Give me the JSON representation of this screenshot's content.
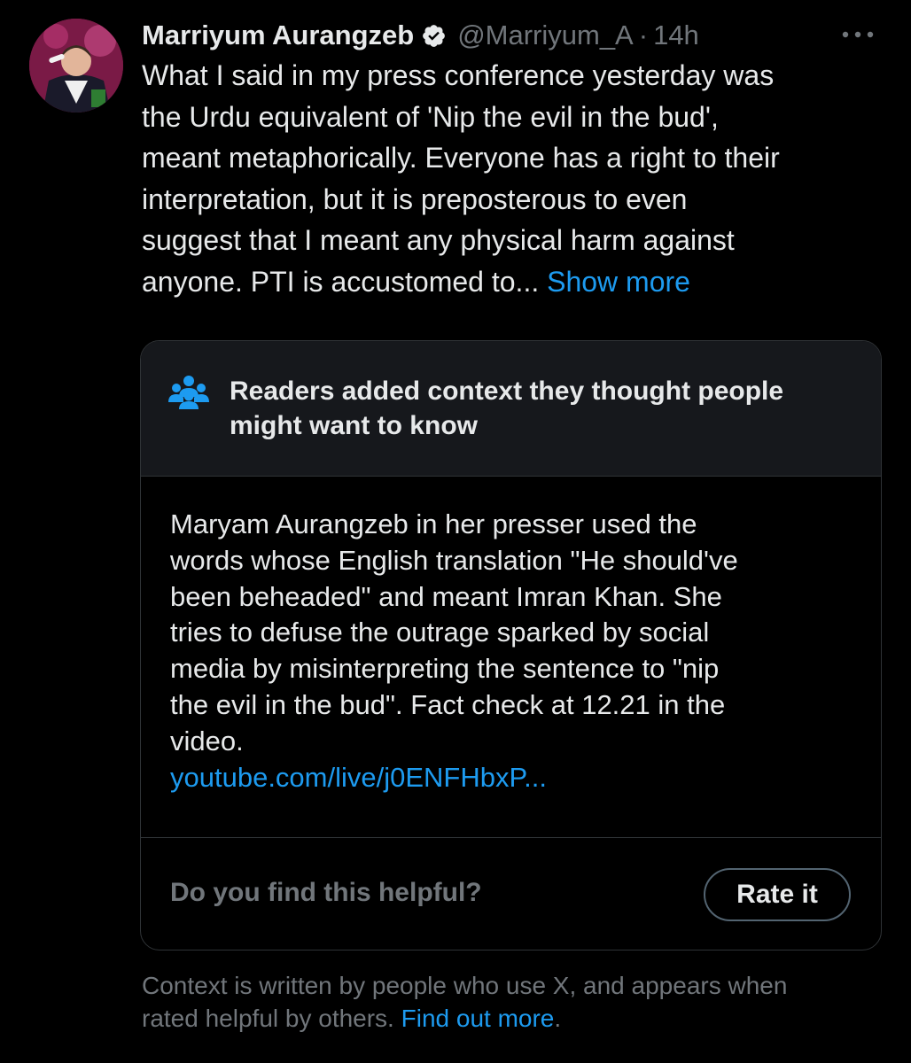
{
  "tweet": {
    "display_name": "Marriyum Aurangzeb",
    "handle": "@Marriyum_A",
    "separator": "·",
    "time": "14h",
    "verified_icon": "verified-badge-icon",
    "more_icon": "more-horizontal-icon",
    "text_lines": [
      "What I said in my press conference yesterday was",
      "the Urdu equivalent of 'Nip the evil in the bud',",
      "meant metaphorically. Everyone has a right to their",
      "interpretation, but it is preposterous to even",
      "suggest that I meant any physical harm against",
      "anyone. PTI is accustomed to... "
    ],
    "show_more": "Show more"
  },
  "community_note": {
    "icon": "people-group-icon",
    "title_lines": [
      "Readers added context they thought people",
      "might want to know"
    ],
    "body_lines": [
      "Maryam Aurangzeb in her presser used the",
      "words whose English translation \"He should've",
      "been beheaded\" and meant Imran Khan. She",
      "tries to defuse the outrage sparked by social",
      "media by misinterpreting the sentence to \"nip",
      "the evil in the bud\". Fact check at 12.21 in the",
      "video."
    ],
    "link": "youtube.com/live/j0ENFHbxP...",
    "helpful_question": "Do you find this helpful?",
    "rate_button": "Rate it"
  },
  "disclaimer": {
    "line1": "Context is written by people who use X, and appears when",
    "line2_prefix": "rated helpful by others. ",
    "find_out_more": "Find out more",
    "line2_suffix": "."
  },
  "colors": {
    "background": "#000000",
    "text": "#e7e9ea",
    "secondary": "#71767b",
    "link": "#1d9bf0",
    "verified": "#e7e9ea"
  }
}
